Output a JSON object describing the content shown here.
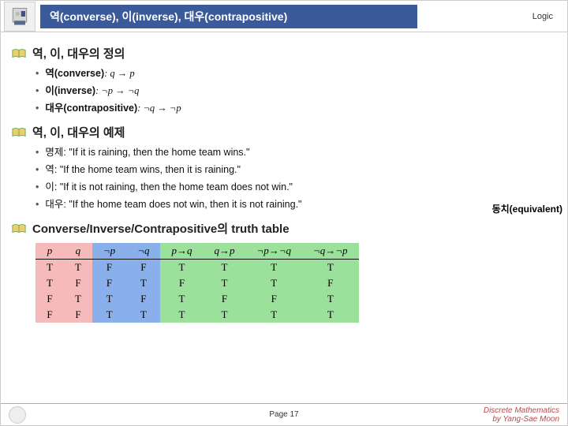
{
  "header": {
    "title": "역(converse), 이(inverse), 대우(contrapositive)",
    "right_label": "Logic"
  },
  "section1": {
    "heading": "역, 이, 대우의 정의",
    "items": [
      {
        "label_bold": "역(converse)",
        "math": ": q → p"
      },
      {
        "label_bold": "이(inverse)",
        "math": ": ¬p → ¬q"
      },
      {
        "label_bold": "대우(contrapositive)",
        "math": ": ¬q → ¬p"
      }
    ]
  },
  "section2": {
    "heading": "역, 이, 대우의 예제",
    "items": [
      {
        "prefix": "명제: ",
        "text": "\"If it is raining, then the home team wins.\""
      },
      {
        "prefix": "역: ",
        "text": "\"If the home team wins, then it is raining.\""
      },
      {
        "prefix": "이: ",
        "text": "\"If it is not raining, then the home team does not win.\""
      },
      {
        "prefix": "대우: ",
        "text": "\"If the home team does not win, then it is not raining.\""
      }
    ],
    "side_note": "동치(equivalent)"
  },
  "section3": {
    "heading": "Converse/Inverse/Contrapositive의 truth table"
  },
  "chart_data": {
    "type": "table",
    "columns": [
      "p",
      "q",
      "¬p",
      "¬q",
      "p→q",
      "q→p",
      "¬p→¬q",
      "¬q→¬p"
    ],
    "column_colors": [
      "red",
      "red",
      "blue",
      "blue",
      "green",
      "green",
      "green",
      "green"
    ],
    "rows": [
      [
        "T",
        "T",
        "F",
        "F",
        "T",
        "T",
        "T",
        "T"
      ],
      [
        "T",
        "F",
        "F",
        "T",
        "F",
        "T",
        "T",
        "F"
      ],
      [
        "F",
        "T",
        "T",
        "F",
        "T",
        "F",
        "F",
        "T"
      ],
      [
        "F",
        "F",
        "T",
        "T",
        "T",
        "T",
        "T",
        "T"
      ]
    ]
  },
  "footer": {
    "page_label": "Page 17",
    "credit_line1": "Discrete Mathematics",
    "credit_line2": "by Yang-Sae Moon"
  }
}
